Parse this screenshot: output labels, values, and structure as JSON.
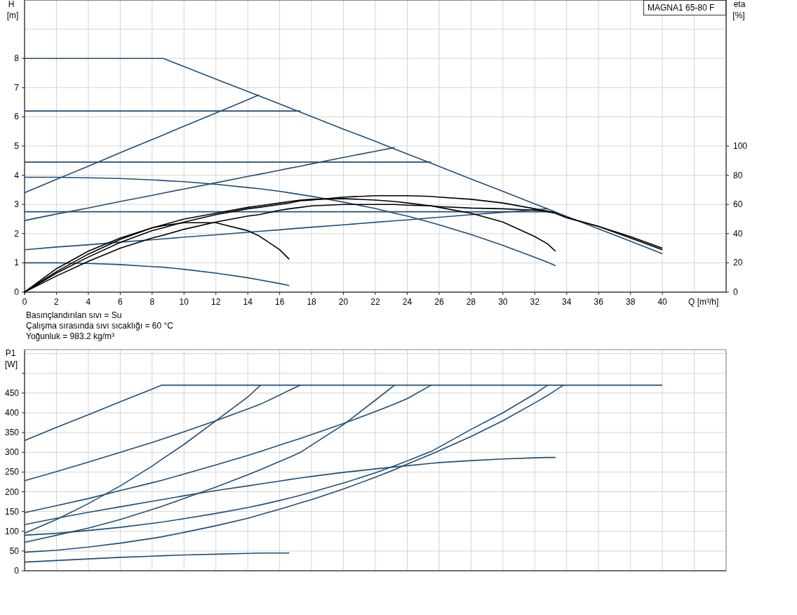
{
  "head_chart": {
    "chart_data": {
      "type": "line",
      "grid": true,
      "title": "MAGNA1 65-80 F",
      "xlabel": "Q [m³/h]",
      "ylabel": [
        "H",
        "[m]"
      ],
      "y2label": [
        "eta",
        "[%]"
      ],
      "xlim": [
        0,
        44
      ],
      "ylim": [
        0,
        10
      ],
      "y2lim": [
        0,
        200
      ],
      "xticks": [
        0,
        2,
        4,
        6,
        8,
        10,
        12,
        14,
        16,
        18,
        20,
        22,
        24,
        26,
        28,
        30,
        32,
        34,
        36,
        38,
        40
      ],
      "yticks": [
        0,
        1,
        2,
        3,
        4,
        5,
        6,
        7,
        8
      ],
      "y2ticks": [
        0,
        20,
        40,
        60,
        80,
        100
      ],
      "x": [
        0,
        2,
        4,
        6,
        8,
        8.7,
        10,
        12,
        14,
        14.7,
        16,
        16.6,
        17.3,
        18,
        20,
        22,
        23.2,
        24,
        25.5,
        26,
        28,
        30,
        32,
        32.8,
        33.3,
        34,
        36,
        38,
        40
      ],
      "series": [
        {
          "color": "#1f4e79",
          "values": [
            8,
            8,
            8,
            8,
            8,
            8,
            7.72,
            7.29,
            6.87,
            6.72,
            6.44,
            6.31,
            6.16,
            6.01,
            5.58,
            5.16,
            4.9,
            4.73,
            4.41,
            4.3,
            3.87,
            3.45,
            3.02,
            2.85,
            2.74,
            2.59,
            2.16,
            1.74,
            1.31
          ]
        },
        {
          "color": "#1f4e79",
          "values": [
            6.2,
            6.2,
            6.2,
            6.2,
            6.2,
            6.2,
            6.2,
            6.2,
            6.2,
            6.2,
            6.2,
            6.2,
            6.2,
            null,
            null,
            null,
            null,
            null,
            null,
            null,
            null,
            null,
            null,
            null,
            null,
            null,
            null,
            null,
            null
          ]
        },
        {
          "color": "#1f4e79",
          "values": [
            4.45,
            4.45,
            4.45,
            4.45,
            4.45,
            4.45,
            4.45,
            4.45,
            4.45,
            4.45,
            4.45,
            4.45,
            4.45,
            4.45,
            4.45,
            4.45,
            4.45,
            4.45,
            4.45,
            null,
            null,
            null,
            null,
            null,
            null,
            null,
            null,
            null,
            null
          ]
        },
        {
          "color": "#1f4e79",
          "values": [
            2.75,
            2.75,
            2.75,
            2.75,
            2.75,
            2.75,
            2.75,
            2.75,
            2.75,
            2.75,
            2.75,
            2.75,
            2.75,
            2.75,
            2.75,
            2.75,
            2.75,
            2.75,
            2.75,
            2.75,
            2.75,
            2.75,
            2.75,
            2.75,
            2.75,
            null,
            null,
            null,
            null
          ]
        },
        {
          "color": "#1f4e79",
          "values": [
            3.4,
            3.86,
            4.31,
            4.77,
            5.22,
            5.38,
            5.68,
            6.13,
            6.59,
            6.75,
            null,
            null,
            null,
            null,
            null,
            null,
            null,
            null,
            null,
            null,
            null,
            null,
            null,
            null,
            null,
            null,
            null,
            null,
            null
          ]
        },
        {
          "color": "#1f4e79",
          "values": [
            2.45,
            2.67,
            2.88,
            3.1,
            3.31,
            3.39,
            3.53,
            3.74,
            3.96,
            4.03,
            4.17,
            4.24,
            4.31,
            4.39,
            4.61,
            4.82,
            4.95,
            null,
            null,
            null,
            null,
            null,
            null,
            null,
            null,
            null,
            null,
            null,
            null
          ]
        },
        {
          "color": "#1f4e79",
          "values": [
            1.45,
            1.54,
            1.62,
            1.71,
            1.79,
            1.82,
            1.88,
            1.96,
            2.05,
            2.08,
            2.13,
            2.16,
            2.19,
            2.22,
            2.3,
            2.39,
            2.44,
            2.47,
            2.54,
            2.56,
            2.65,
            2.73,
            2.82,
            2.85,
            null,
            null,
            null,
            null,
            null
          ]
        },
        {
          "color": "#1f4e79",
          "values": [
            3.93,
            3.93,
            3.91,
            3.89,
            3.84,
            3.82,
            3.78,
            3.69,
            3.58,
            3.54,
            3.45,
            3.4,
            3.34,
            3.28,
            3.08,
            2.86,
            2.7,
            2.6,
            2.38,
            2.3,
            1.97,
            1.6,
            1.19,
            1.02,
            0.9,
            null,
            null,
            null,
            null
          ]
        },
        {
          "color": "#1f4e79",
          "values": [
            1,
            1,
            0.98,
            0.94,
            0.87,
            0.85,
            0.78,
            0.65,
            0.49,
            0.42,
            0.29,
            0.22,
            null,
            null,
            null,
            null,
            null,
            null,
            null,
            null,
            null,
            null,
            null,
            null,
            null,
            null,
            null,
            null,
            null
          ]
        },
        {
          "axis": "y2",
          "color": "#000000",
          "values": [
            0,
            16,
            28,
            37,
            44,
            45.5,
            47.5,
            47.5,
            42,
            38.5,
            29,
            22.4,
            null,
            null,
            null,
            null,
            null,
            null,
            null,
            null,
            null,
            null,
            null,
            null,
            null,
            null,
            null,
            null,
            null
          ]
        },
        {
          "axis": "y2",
          "color": "#000000",
          "values": [
            0,
            14,
            26,
            36,
            44,
            46,
            50,
            54,
            58,
            59,
            61,
            62,
            63,
            63.5,
            64,
            63,
            62,
            61,
            59,
            58,
            54,
            48,
            38,
            33,
            28,
            null,
            null,
            null,
            null
          ]
        },
        {
          "axis": "y2",
          "color": "#000000",
          "values": [
            0,
            13,
            24,
            34,
            42,
            44,
            48,
            53,
            57,
            58,
            60,
            61,
            62.5,
            63,
            65,
            66,
            66,
            66,
            65.5,
            65,
            63.5,
            61,
            57,
            55,
            54,
            51,
            45,
            38,
            30
          ]
        },
        {
          "axis": "y2",
          "color": "#000000",
          "values": [
            0,
            11,
            21,
            30,
            37,
            39,
            43,
            48,
            52,
            53,
            56,
            57,
            58,
            59,
            60,
            60,
            60,
            59.5,
            59,
            58.5,
            57.5,
            57,
            56,
            55.5,
            54,
            51,
            45,
            37,
            29
          ]
        }
      ]
    }
  },
  "fluid_notes": [
    "Basınçlandırılan sıvı = Su",
    "Çalışma sırasında sıvı sıcaklığı = 60 °C",
    "Yoğunluk = 983.2 kg/m³"
  ],
  "power_chart": {
    "chart_data": {
      "type": "line",
      "grid": true,
      "ylabel": [
        "P1",
        "[W]"
      ],
      "xlim": [
        0,
        44
      ],
      "ylim": [
        0,
        560
      ],
      "yticks": [
        0,
        50,
        100,
        150,
        200,
        250,
        300,
        350,
        400,
        450
      ],
      "x": [
        0,
        2,
        4,
        6,
        8,
        8.6,
        10,
        12,
        14,
        14.8,
        16,
        16.6,
        17.3,
        18,
        20,
        22,
        23.2,
        24,
        25.5,
        26,
        28,
        30,
        32,
        32.8,
        33.3,
        33.8,
        34,
        36,
        38,
        40
      ],
      "series": [
        {
          "color": "#1f4e79",
          "values": [
            330,
            363,
            395,
            428,
            460,
            470,
            470,
            470,
            470,
            470,
            470,
            470,
            470,
            470,
            470,
            470,
            470,
            470,
            470,
            470,
            470,
            470,
            470,
            470,
            470,
            470,
            470,
            470,
            470,
            470
          ]
        },
        {
          "color": "#1f4e79",
          "values": [
            228,
            251,
            275,
            300,
            325,
            333,
            352,
            380,
            410,
            422,
            445,
            457,
            470,
            null,
            null,
            null,
            null,
            null,
            null,
            null,
            null,
            null,
            null,
            null,
            null,
            null,
            null,
            null,
            null,
            null
          ]
        },
        {
          "color": "#1f4e79",
          "values": [
            95,
            130,
            170,
            215,
            265,
            282,
            320,
            380,
            440,
            470,
            null,
            null,
            null,
            null,
            null,
            null,
            null,
            null,
            null,
            null,
            null,
            null,
            null,
            null,
            null,
            null,
            null,
            null,
            null,
            null
          ]
        },
        {
          "color": "#1f4e79",
          "values": [
            147,
            165,
            183,
            203,
            223,
            229,
            245,
            268,
            292,
            302,
            318,
            326,
            335,
            345,
            373,
            403,
            422,
            436,
            470,
            null,
            null,
            null,
            null,
            null,
            null,
            null,
            null,
            null,
            null,
            null
          ]
        },
        {
          "color": "#1f4e79",
          "values": [
            72,
            90,
            108,
            130,
            155,
            163,
            183,
            212,
            243,
            256,
            277,
            287,
            300,
            318,
            370,
            432,
            470,
            null,
            null,
            null,
            null,
            null,
            null,
            null,
            null,
            null,
            null,
            null,
            null,
            null
          ]
        },
        {
          "color": "#1f4e79",
          "values": [
            117,
            133,
            148,
            162,
            176,
            180,
            190,
            203,
            215,
            220,
            227,
            231,
            235,
            239,
            249,
            258,
            263,
            266,
            272,
            274,
            279,
            283,
            286,
            287,
            287,
            null,
            null,
            null,
            null,
            null
          ]
        },
        {
          "color": "#1f4e79",
          "values": [
            90,
            95,
            102,
            110,
            120,
            123,
            132,
            145,
            160,
            167,
            178,
            184,
            191,
            199,
            222,
            248,
            266,
            278,
            302,
            313,
            358,
            400,
            448,
            470,
            null,
            null,
            null,
            null,
            null,
            null
          ]
        },
        {
          "color": "#1f4e79",
          "values": [
            47,
            52,
            60,
            70,
            82,
            86,
            97,
            114,
            133,
            142,
            156,
            163,
            172,
            180,
            207,
            237,
            256,
            270,
            295,
            304,
            340,
            380,
            425,
            444,
            457,
            470,
            null,
            null,
            null,
            null
          ]
        },
        {
          "color": "#1f4e79",
          "values": [
            22,
            26,
            30,
            34,
            37,
            38,
            40,
            42,
            44,
            45,
            45,
            45,
            null,
            null,
            null,
            null,
            null,
            null,
            null,
            null,
            null,
            null,
            null,
            null,
            null,
            null,
            null,
            null,
            null,
            null
          ]
        }
      ]
    }
  }
}
